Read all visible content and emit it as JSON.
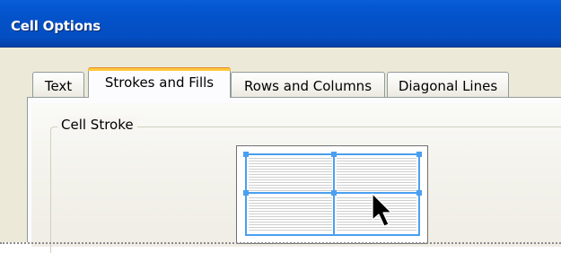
{
  "window": {
    "title": "Cell Options"
  },
  "tabs": [
    {
      "label": "Text",
      "active": false
    },
    {
      "label": "Strokes and Fills",
      "active": true
    },
    {
      "label": "Rows and Columns",
      "active": false
    },
    {
      "label": "Diagonal Lines",
      "active": false
    }
  ],
  "cell_stroke": {
    "group_label": "Cell Stroke",
    "proxy_grid": {
      "rows": 2,
      "columns": 2
    },
    "selection_color": "#4a9ff0"
  },
  "colors": {
    "titlebar": "#0450c6",
    "active_tab_accent": "#ffc83c",
    "dialog_background": "#ece9d8"
  }
}
